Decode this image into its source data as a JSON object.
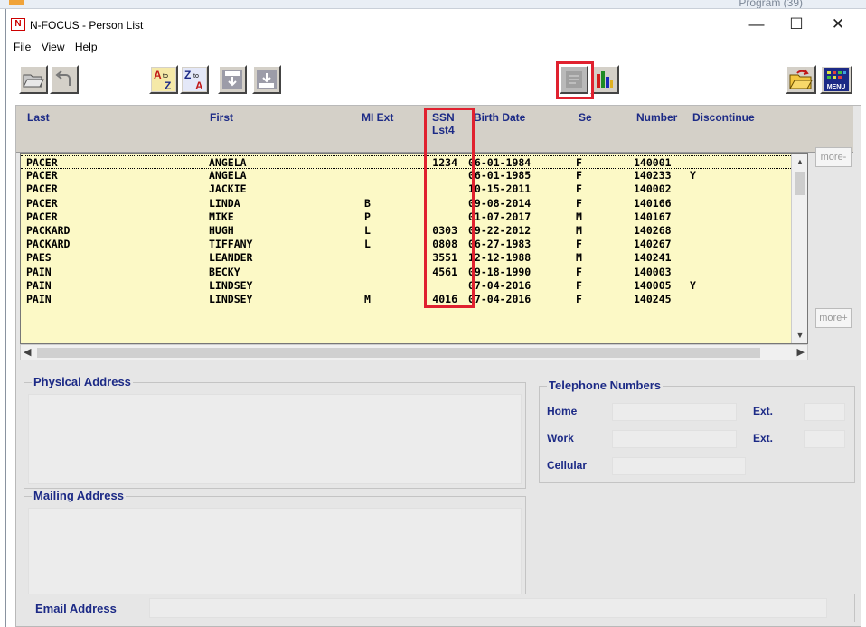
{
  "background": {
    "partial_text": "Program (39)"
  },
  "window": {
    "title": "N-FOCUS - Person List",
    "app_icon_text": "N",
    "controls": {
      "minimize": "—",
      "maximize": "☐",
      "close": "✕"
    }
  },
  "menu": [
    "File",
    "View",
    "Help"
  ],
  "toolbar": {
    "highlight_color": "#e0212f",
    "sort_az": {
      "top": "A",
      "bottom": "Z",
      "arrow": "to"
    },
    "sort_za": {
      "top": "Z",
      "bottom": "A",
      "arrow": "to"
    },
    "menu_icon_text": "MENU"
  },
  "grid": {
    "headers": {
      "last": "Last",
      "first": "First",
      "mi_ext": "MI Ext",
      "ssn": "SSN\nLst4",
      "birth": "Birth Date",
      "sex": "Se",
      "number": "Number",
      "disc": "Discontinue"
    },
    "rows": [
      {
        "last": "PACER",
        "first": "ANGELA",
        "mi": "",
        "ssn": "1234",
        "birth": "06-01-1984",
        "sex": "F",
        "number": "140001",
        "disc": ""
      },
      {
        "last": "PACER",
        "first": "ANGELA",
        "mi": "",
        "ssn": "",
        "birth": "06-01-1985",
        "sex": "F",
        "number": "140233",
        "disc": "Y"
      },
      {
        "last": "PACER",
        "first": "JACKIE",
        "mi": "",
        "ssn": "",
        "birth": "10-15-2011",
        "sex": "F",
        "number": "140002",
        "disc": ""
      },
      {
        "last": "PACER",
        "first": "LINDA",
        "mi": "B",
        "ssn": "",
        "birth": "09-08-2014",
        "sex": "F",
        "number": "140166",
        "disc": ""
      },
      {
        "last": "PACER",
        "first": "MIKE",
        "mi": "P",
        "ssn": "",
        "birth": "01-07-2017",
        "sex": "M",
        "number": "140167",
        "disc": ""
      },
      {
        "last": "PACKARD",
        "first": "HUGH",
        "mi": "L",
        "ssn": "0303",
        "birth": "09-22-2012",
        "sex": "M",
        "number": "140268",
        "disc": ""
      },
      {
        "last": "PACKARD",
        "first": "TIFFANY",
        "mi": "L",
        "ssn": "0808",
        "birth": "06-27-1983",
        "sex": "F",
        "number": "140267",
        "disc": ""
      },
      {
        "last": "PAES",
        "first": "LEANDER",
        "mi": "",
        "ssn": "3551",
        "birth": "12-12-1988",
        "sex": "M",
        "number": "140241",
        "disc": ""
      },
      {
        "last": "PAIN",
        "first": "BECKY",
        "mi": "",
        "ssn": "4561",
        "birth": "09-18-1990",
        "sex": "F",
        "number": "140003",
        "disc": ""
      },
      {
        "last": "PAIN",
        "first": "LINDSEY",
        "mi": "",
        "ssn": "",
        "birth": "07-04-2016",
        "sex": "F",
        "number": "140005",
        "disc": "Y"
      },
      {
        "last": "PAIN",
        "first": "LINDSEY",
        "mi": "M",
        "ssn": "4016",
        "birth": "07-04-2016",
        "sex": "F",
        "number": "140245",
        "disc": ""
      }
    ],
    "more_up": "more-",
    "more_down": "more+"
  },
  "details": {
    "physical_address": "Physical Address",
    "mailing_address": "Mailing Address",
    "email_address": "Email Address",
    "telephone": {
      "title": "Telephone Numbers",
      "home": "Home",
      "work": "Work",
      "cellular": "Cellular",
      "ext": "Ext."
    }
  }
}
